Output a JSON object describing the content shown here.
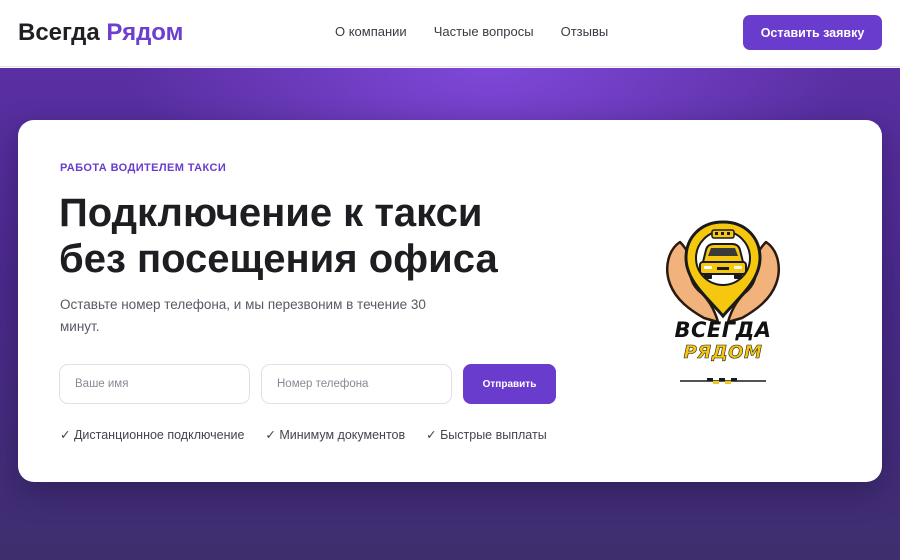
{
  "header": {
    "brand_part1": "Всегда",
    "brand_part2": "Рядом",
    "nav": [
      "О компании",
      "Частые вопросы",
      "Отзывы"
    ],
    "cta_label": "Оставить заявку"
  },
  "hero": {
    "eyebrow": "РАБОТА ВОДИТЕЛЕМ ТАКСИ",
    "title_line1": "Подключение к такси",
    "title_line2": "без посещения офиса",
    "subtitle": "Оставьте номер телефона, и мы перезвоним в течение 30 минут.",
    "form": {
      "name_placeholder": "Ваше имя",
      "phone_placeholder": "Номер телефона",
      "submit_label": "Отправить"
    },
    "features": [
      "✓ Дистанционное подключение",
      "✓ Минимум документов",
      "✓ Быстрые выплаты"
    ]
  },
  "logo": {
    "line1": "ВСЕГДА",
    "line2": "РЯДОМ",
    "icon": "taxi-hands-logo"
  },
  "colors": {
    "accent": "#6a3ccd",
    "brand_purple": "#6d3fcf",
    "taxi_yellow": "#f6c70f",
    "hero_bg": "#4b2a8c"
  }
}
